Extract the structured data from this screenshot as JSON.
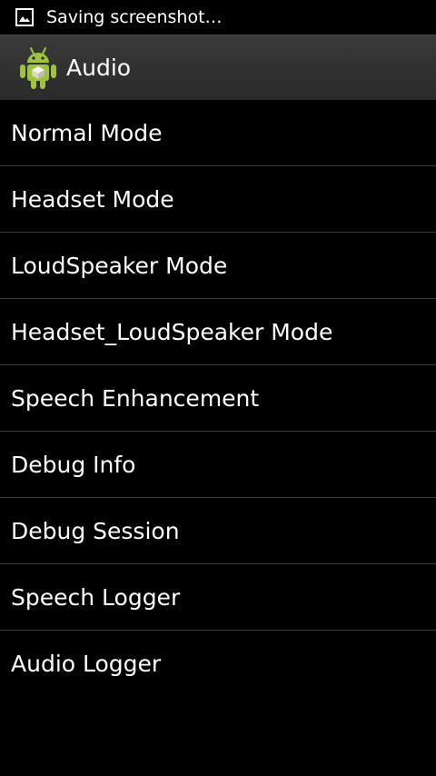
{
  "status_bar": {
    "icon": "image-icon",
    "text": "Saving screenshot…"
  },
  "action_bar": {
    "icon": "android-icon",
    "title": "Audio"
  },
  "menu": {
    "items": [
      {
        "label": "Normal Mode"
      },
      {
        "label": "Headset Mode"
      },
      {
        "label": "LoudSpeaker Mode"
      },
      {
        "label": "Headset_LoudSpeaker Mode"
      },
      {
        "label": "Speech Enhancement"
      },
      {
        "label": "Debug Info"
      },
      {
        "label": "Debug Session"
      },
      {
        "label": "Speech Logger"
      },
      {
        "label": "Audio Logger"
      }
    ]
  },
  "colors": {
    "background": "#000000",
    "action_bar": "#333333",
    "divider": "#3a3a3a",
    "android_green": "#9fc33f",
    "text": "#ffffff"
  }
}
